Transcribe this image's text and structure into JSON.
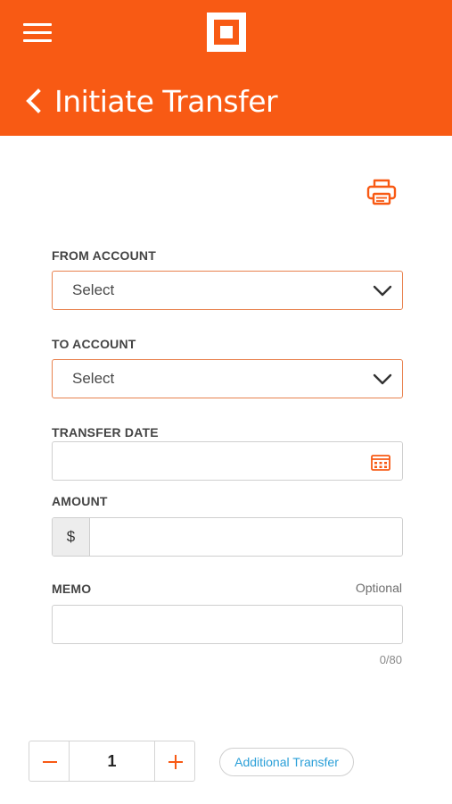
{
  "header": {
    "title": "Initiate Transfer",
    "menu_icon": "hamburger-menu-icon",
    "logo_icon": "square-logo-icon",
    "back_icon": "chevron-left-icon",
    "background_color": "#f85a14"
  },
  "toolbar": {
    "print_icon": "printer-icon"
  },
  "form": {
    "from_account": {
      "label": "FROM ACCOUNT",
      "value": "Select"
    },
    "to_account": {
      "label": "TO ACCOUNT",
      "value": "Select"
    },
    "transfer_date": {
      "label": "TRANSFER DATE",
      "value": "",
      "icon": "calendar-icon"
    },
    "amount": {
      "label": "AMOUNT",
      "currency_symbol": "$",
      "value": ""
    },
    "memo": {
      "label": "MEMO",
      "optional_label": "Optional",
      "value": "",
      "char_count": "0/80"
    }
  },
  "stepper": {
    "value": "1",
    "minus_icon": "minus-icon",
    "plus_icon": "plus-icon"
  },
  "additional_transfer": {
    "label": "Additional Transfer"
  },
  "colors": {
    "accent": "#f85a14",
    "select_border": "#e8824f",
    "link": "#2a9fd8"
  }
}
